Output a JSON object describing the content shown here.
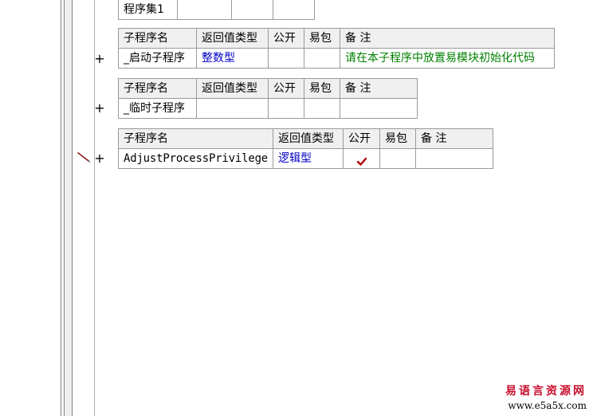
{
  "assembly_table": {
    "cells": [
      "程序集1",
      "",
      "",
      ""
    ]
  },
  "header_labels": {
    "name": "子程序名",
    "return_type": "返回值类型",
    "public": "公开",
    "package": "易包",
    "remark": "备 注"
  },
  "subroutines": [
    {
      "expand": "+",
      "name": "_启动子程序",
      "return_type": "整数型",
      "public": "",
      "package": "",
      "remark": "请在本子程序中放置易模块初始化代码"
    },
    {
      "expand": "+",
      "name": "_临时子程序",
      "return_type": "",
      "public": "",
      "package": "",
      "remark": ""
    },
    {
      "expand": "+",
      "name": "AdjustProcessPrivilege",
      "return_type": "逻辑型",
      "public_checked": true,
      "package": "",
      "remark": ""
    }
  ],
  "colors": {
    "type_text": "#0000c8",
    "remark_text": "#008000",
    "check_mark": "#b00000",
    "watermark": "#c8102e"
  },
  "icons": {
    "edit_marker": "pencil-icon",
    "public_mark": "check-icon"
  },
  "watermark": {
    "cn": "易语言资源网",
    "url": "www.e5a5x.com"
  }
}
